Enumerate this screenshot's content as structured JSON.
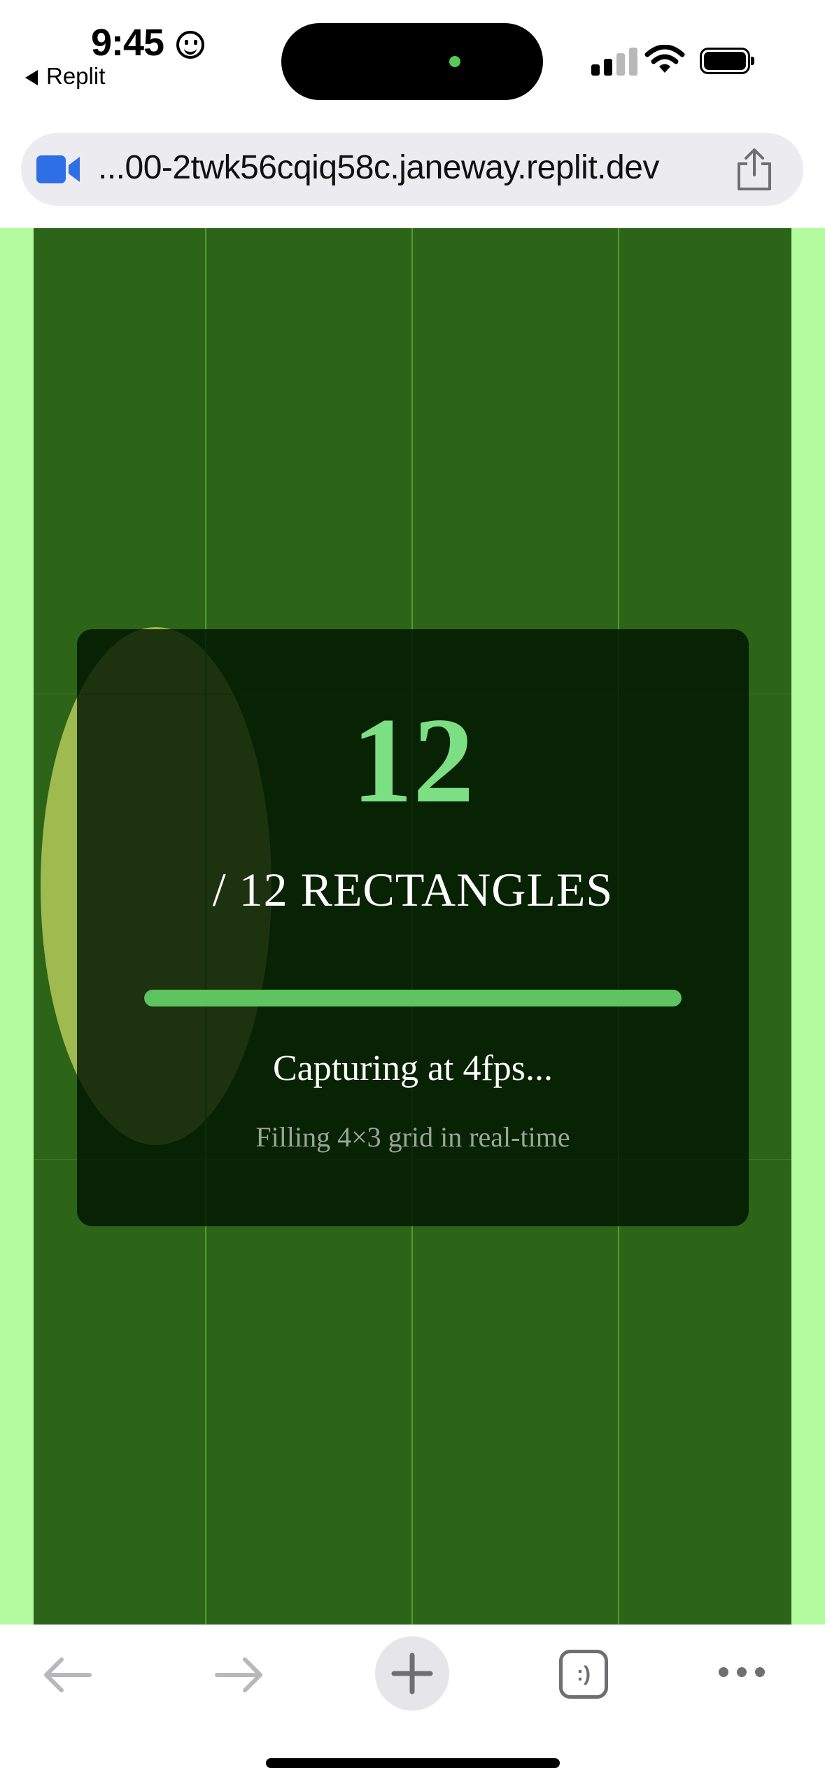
{
  "status_bar": {
    "time": "9:45",
    "back_app": "Replit"
  },
  "browser": {
    "url": "...00-2twk56cqiq58c.janeway.replit.dev",
    "site_icon": "video-camera-icon",
    "share_icon": "share-icon"
  },
  "capture_card": {
    "count": "12",
    "subtitle": "/ 12 RECTANGLES",
    "progress": 1.0,
    "status": "Capturing at 4fps...",
    "detail": "Filling 4×3 grid in real-time"
  },
  "toolbar": {
    "items": [
      "back-arrow-icon",
      "forward-arrow-icon",
      "new-tab-plus-icon",
      "tabs-icon",
      "more-icon"
    ],
    "tabs_label": ":)"
  },
  "colors": {
    "page_bg": "#b2fb9e",
    "grid_bg": "#2c6418",
    "accent": "#7ddf83",
    "progress": "#5fc35f",
    "url_icon": "#2f6fe6"
  }
}
